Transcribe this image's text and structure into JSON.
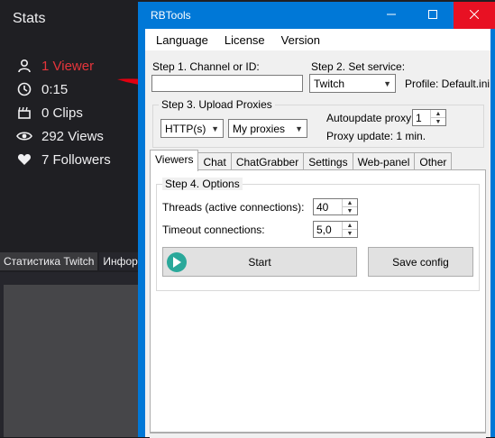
{
  "background": {
    "title": "Stats",
    "stats": [
      {
        "icon": "user-icon",
        "text": "1 Viewer"
      },
      {
        "icon": "clock-icon",
        "text": "0:15"
      },
      {
        "icon": "clapper-icon",
        "text": "0 Clips"
      },
      {
        "icon": "eye-icon",
        "text": "292 Views"
      },
      {
        "icon": "heart-icon",
        "text": "7 Followers"
      }
    ],
    "tabs": [
      "Статистика Twitch",
      "Информа"
    ]
  },
  "window": {
    "title": "RBTools",
    "menu": [
      "Language",
      "License",
      "Version"
    ],
    "step1_label": "Step 1. Channel or ID:",
    "channel_value": "",
    "step2_label": "Step 2. Set service:",
    "service_value": "Twitch",
    "profile_label": "Profile: Default.ini",
    "step3_label": "Step 3. Upload Proxies",
    "proxy_type": "HTTP(s)",
    "proxy_source": "My proxies",
    "autoupdate_label": "Autoupdate proxy:",
    "autoupdate_value": "1",
    "proxy_update_label": "Proxy update: 1 min.",
    "tabs": [
      "Viewers",
      "Chat",
      "ChatGrabber",
      "Settings",
      "Web-panel",
      "Other"
    ],
    "step4_label": "Step 4. Options",
    "threads_label": "Threads (active connections):",
    "threads_value": "40",
    "timeout_label": "Timeout connections:",
    "timeout_value": "5,0",
    "start_label": "Start",
    "save_label": "Save config"
  },
  "colors": {
    "accent": "#0078d7",
    "viewer_red": "#e5353b",
    "close_red": "#e81123",
    "play_teal": "#2aa89a"
  }
}
